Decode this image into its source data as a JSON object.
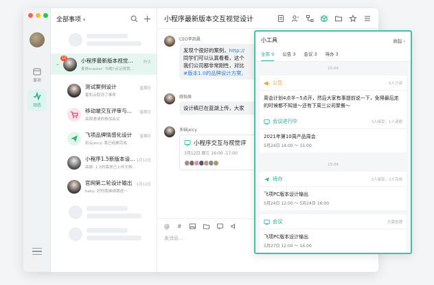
{
  "list": {
    "filter_label": "全部事项",
    "conversations": [
      {
        "name": "小程序最新版本视觉...",
        "preview": "麦林master: 今晚7点记得我们开分...",
        "time": "昨天",
        "badge": "10"
      },
      {
        "name": "测试案例设计",
        "preview": "霍彩云取消了事项",
        "time": "星期日",
        "badge": ""
      },
      {
        "name": "移动端交互评审与...",
        "preview": "高周邀请你参加会议",
        "time": "星期日",
        "badge": ""
      },
      {
        "name": "飞项品牌情感化设计",
        "preview": "彩云jeicy: 我已经确完成",
        "time": "星期日",
        "badge": ""
      },
      {
        "name": "小程序1.5新版本设...",
        "preview": "高颖: 1.5的需求已上传文档...",
        "time": "1月12日",
        "badge": ""
      },
      {
        "name": "官网第二轮设计输出",
        "preview": "baby: 好的我继续跟进～",
        "time": "1月12日",
        "badge": ""
      }
    ]
  },
  "rail": {
    "items": [
      {
        "label": "事项"
      },
      {
        "label": "动态"
      }
    ]
  },
  "chat": {
    "title": "小程序最新版本交互视觉设计",
    "messages": [
      {
        "sender": "CEO李凯晨",
        "text_1": "发现个很好的案例，",
        "link": "http://",
        "text_2": "同学们可以认真看看，这个",
        "text_3": "我们公司都非常刚性，对比",
        "text_4": "#版本1.0的品牌设计方案,"
      },
      {
        "sender": "姚怡辰",
        "text": "设计稿已在蓝湖上传，大家"
      },
      {
        "sender": "多妹jeicy",
        "card_title": "小程序交互与视觉评",
        "card_date": "3月12日 周三 16:00 -17:00"
      }
    ],
    "composer_placeholder": "发消息..."
  },
  "panel": {
    "title": "小工具",
    "collapse_label": "收起 ›",
    "tabs": [
      {
        "label": "全部 9"
      },
      {
        "label": "公告 3"
      },
      {
        "label": "会议 3"
      },
      {
        "label": "待办 3"
      }
    ],
    "dates": [
      "15:09",
      "15:09"
    ],
    "cards": [
      {
        "kind": "公告",
        "meta": "5人已读",
        "text": "周会计划4点半~5点开，然后大家有事提前说一下，免得最后走的时候都不知道～还有下周三公司聚餐～",
        "sub": ""
      },
      {
        "kind": "会议进行中",
        "meta": "3人接受，1人请假",
        "text": "2021年第10周产品周会",
        "sub": "5月24日 14:00 ～ 15:00"
      },
      {
        "kind": "待办",
        "meta": "3人接受，2人完成",
        "text": "飞项PC版本设计输出",
        "sub": "5月24日 12:00 ～ 5月24日 16:00"
      },
      {
        "kind": "会议",
        "meta": "无需处理",
        "text": "飞项PC版本设计输出",
        "sub": "5月27日 12:00 ～ 16:00"
      }
    ]
  },
  "colors": {
    "accent": "#3ec2a6",
    "notice": "#f29f3a",
    "badge": "#f5543a"
  }
}
